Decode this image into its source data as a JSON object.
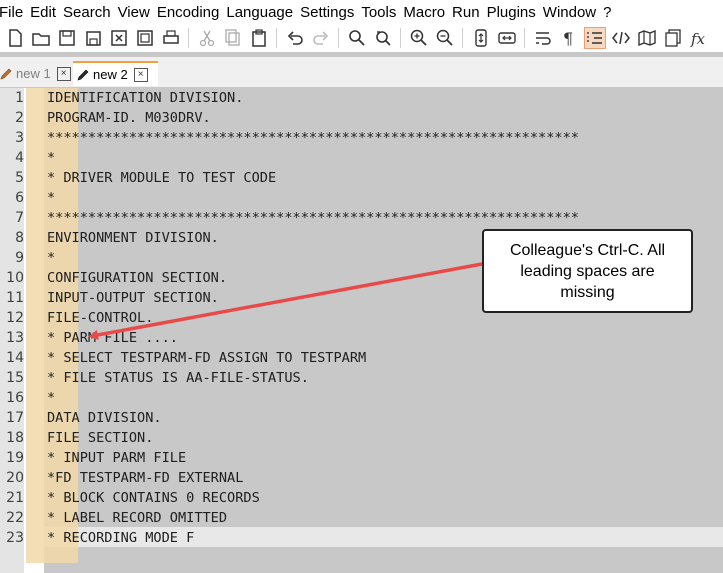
{
  "menu": [
    "File",
    "Edit",
    "Search",
    "View",
    "Encoding",
    "Language",
    "Settings",
    "Tools",
    "Macro",
    "Run",
    "Plugins",
    "Window",
    "?"
  ],
  "toolbar": {
    "icons": [
      "new-file-icon",
      "open-file-icon",
      "save-icon",
      "save-all-icon",
      "close-icon",
      "close-all-icon",
      "print-icon",
      "cut-icon",
      "copy-icon",
      "paste-icon",
      "undo-icon",
      "redo-icon",
      "find-icon",
      "replace-icon",
      "zoom-in-icon",
      "zoom-out-icon",
      "sync-vertical-icon",
      "sync-horizontal-icon",
      "word-wrap-icon",
      "show-all-chars-icon",
      "indent-guide-icon",
      "xml-tags-icon",
      "document-map-icon",
      "document-list-icon",
      "function-list-icon"
    ],
    "active_icon": "indent-guide-icon"
  },
  "tabs": [
    {
      "label": "new 1",
      "active": false
    },
    {
      "label": "new 2",
      "active": true,
      "modified": true
    }
  ],
  "editor": {
    "lines": [
      {
        "num": "1",
        "text": "IDENTIFICATION DIVISION."
      },
      {
        "num": "2",
        "text": "PROGRAM-ID. M030DRV."
      },
      {
        "num": "3",
        "text": "*****************************************************************"
      },
      {
        "num": "4",
        "text": "*"
      },
      {
        "num": "5",
        "text": "* DRIVER MODULE TO TEST CODE"
      },
      {
        "num": "6",
        "text": "*"
      },
      {
        "num": "7",
        "text": "*****************************************************************"
      },
      {
        "num": "8",
        "text": "ENVIRONMENT DIVISION."
      },
      {
        "num": "9",
        "text": "*"
      },
      {
        "num": "10",
        "text": "CONFIGURATION SECTION."
      },
      {
        "num": "11",
        "text": "INPUT-OUTPUT SECTION."
      },
      {
        "num": "12",
        "text": "FILE-CONTROL."
      },
      {
        "num": "13",
        "text": "* PARM FILE ...."
      },
      {
        "num": "14",
        "text": "* SELECT TESTPARM-FD ASSIGN TO TESTPARM"
      },
      {
        "num": "15",
        "text": "* FILE STATUS IS AA-FILE-STATUS."
      },
      {
        "num": "16",
        "text": "*"
      },
      {
        "num": "17",
        "text": "DATA DIVISION."
      },
      {
        "num": "18",
        "text": "FILE SECTION."
      },
      {
        "num": "19",
        "text": "* INPUT PARM FILE"
      },
      {
        "num": "20",
        "text": "*FD TESTPARM-FD EXTERNAL"
      },
      {
        "num": "21",
        "text": "* BLOCK CONTAINS 0 RECORDS"
      },
      {
        "num": "22",
        "text": "* LABEL RECORD OMITTED"
      },
      {
        "num": "23",
        "text": "* RECORDING MODE F"
      }
    ],
    "current_line": "23"
  },
  "annotation": {
    "text": "Colleague's Ctrl-C. All leading spaces are missing",
    "arrow_color": "#e84a4a"
  },
  "colors": {
    "editor_bg": "#c8c8c8",
    "indent_highlight": "#f2d8a8",
    "active_tab_accent": "#f5a040"
  }
}
